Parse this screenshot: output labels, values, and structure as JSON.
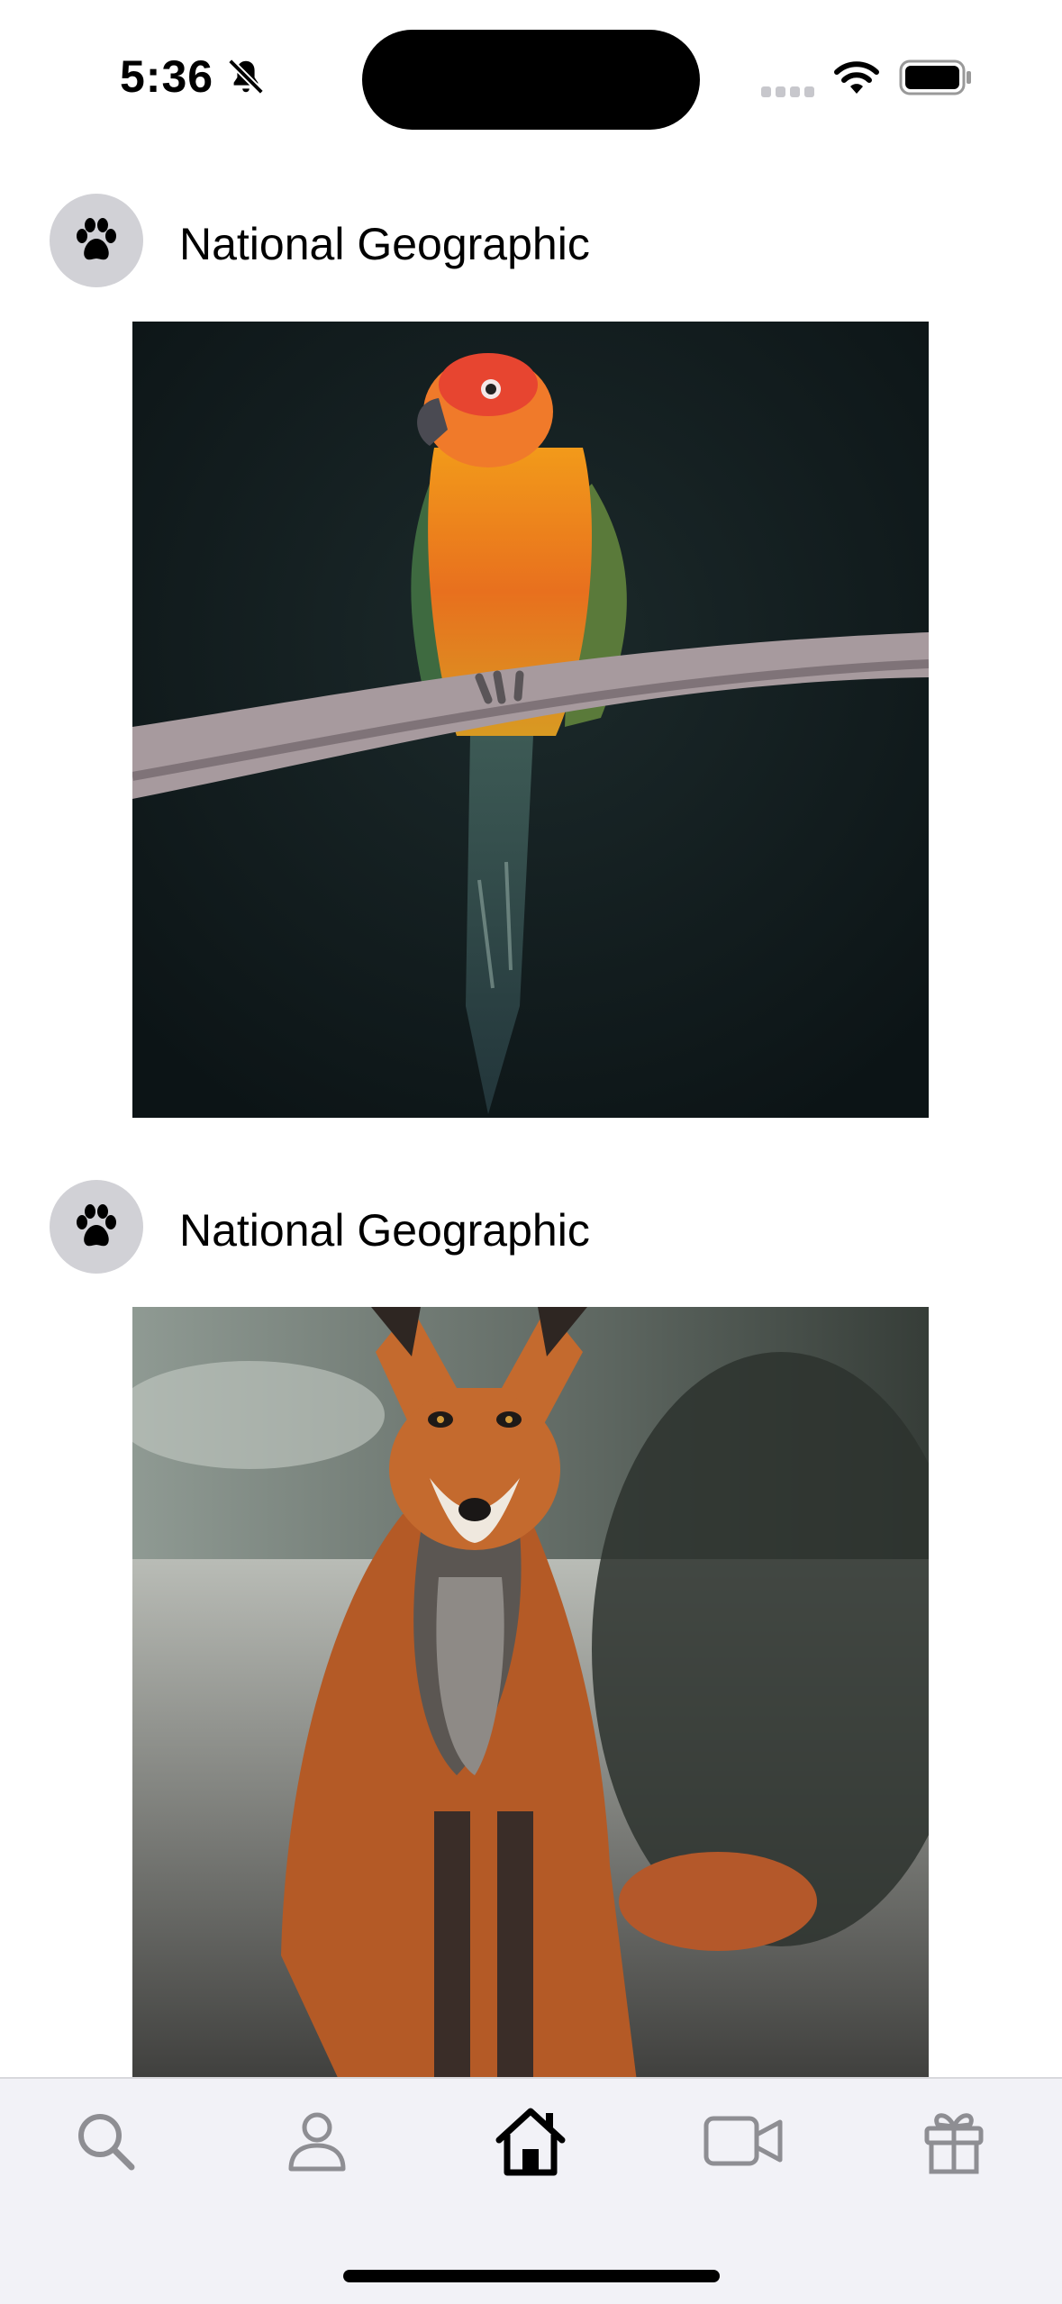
{
  "status_bar": {
    "time": "5:36",
    "icons": [
      "bell-slash-icon",
      "cellular-signal-icon",
      "wifi-icon",
      "battery-icon"
    ]
  },
  "feed": {
    "posts": [
      {
        "author": "National Geographic",
        "avatar_icon": "paw-icon",
        "image": "parrot-photo"
      },
      {
        "author": "National Geographic",
        "avatar_icon": "paw-icon",
        "image": "fox-photo"
      }
    ]
  },
  "tab_bar": {
    "tabs": [
      {
        "icon": "search-icon",
        "selected": false
      },
      {
        "icon": "person-icon",
        "selected": false
      },
      {
        "icon": "home-icon",
        "selected": true
      },
      {
        "icon": "video-icon",
        "selected": false
      },
      {
        "icon": "gift-icon",
        "selected": false
      }
    ],
    "colors": {
      "selected": "#000000",
      "unselected": "#8e8e93"
    }
  }
}
